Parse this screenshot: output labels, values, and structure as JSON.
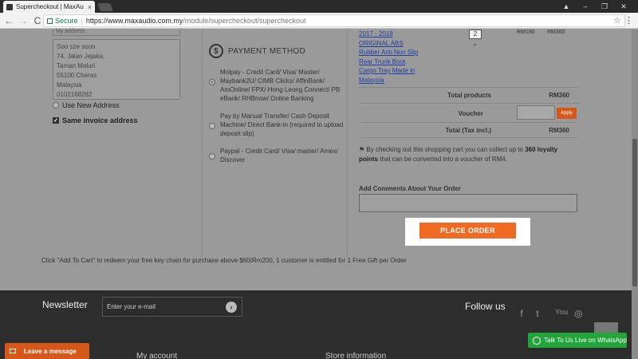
{
  "browser": {
    "tab_title": "Supercheckout | MaxAu",
    "tab_close": "×",
    "secure_label": "Secure",
    "url_host": "https://www.maxaudio.com.my",
    "url_path": "/module/supercheckout/supercheckout",
    "back": "←",
    "forward": "→",
    "reload": "C",
    "star": "☆",
    "menu": "⋮",
    "minimize": "–",
    "maximize": "❐",
    "close": "✕",
    "account": "▲"
  },
  "address": {
    "top_label": "My address",
    "lines": [
      "Soo sze soon",
      "74, Jalan Jejaka,",
      "Taman Maluri",
      "55100 Cheras",
      "Malaysia",
      "0102168282"
    ],
    "use_new_address": "Use New Address",
    "same_invoice": "Same invoice address"
  },
  "payment": {
    "heading": "PAYMENT METHOD",
    "icon_glyph": "$",
    "options": [
      {
        "label": "Molpay - Credit Card/ Visa/ Master/ Maybank2U/ CIMB Clicks/ AffinBank/ AmOnline/ FPX/ Hong Leong Connect/ PB eBank/ RHBnow/ Online Banking",
        "selected": true
      },
      {
        "label": "Pay by Manual Transfer/ Cash Deposit Machine/ Direct Bank-in (required to upload deposit slip)",
        "selected": false
      },
      {
        "label": "Paypal - Credit Card/ Visa/ master/ Amex/ Discover",
        "selected": false
      }
    ]
  },
  "cart": {
    "product_links": [
      "2017 - 2018",
      "ORIGINAL ABS",
      "Rubber Anti Non Slip",
      "Rear Trunk Boot",
      "Cargo Tray Made in",
      "Malaysia"
    ],
    "qty": "2",
    "unit_price": "RM180",
    "line_total": "RM360",
    "total_products_label": "Total products",
    "total_products_value": "RM360",
    "voucher_label": "Voucher",
    "apply_label": "Apply",
    "total_label": "Total (Tax incl.)",
    "total_value": "RM360",
    "loyalty_prefix": "By checking out this shopping cart you can collect up to ",
    "loyalty_points": "360 loyalty points",
    "loyalty_suffix": " that can be converted into a voucher of RM4.",
    "comment_label": "Add Comments About Your Order",
    "place_order": "PLACE ORDER"
  },
  "free_gift_note": "Click \"Add To Cart\" to redeem your free key chain for purchase above $60/Rm200, 1 customer is entitled for 1 Free Gift per Order",
  "footer": {
    "newsletter_label": "Newsletter",
    "newsletter_placeholder": "Enter your e-mail",
    "follow_label": "Follow us",
    "social": [
      "f",
      "t",
      "You",
      "◎"
    ],
    "my_account": "My account",
    "store_info": "Store information",
    "back_to_top": "︿",
    "whatsapp": "Talk To Us Live on WhatsApp",
    "leave_message": "Leave a message"
  },
  "colors": {
    "accent": "#ef6b23",
    "whatsapp": "#22a53a",
    "link": "#1f3fa8"
  }
}
